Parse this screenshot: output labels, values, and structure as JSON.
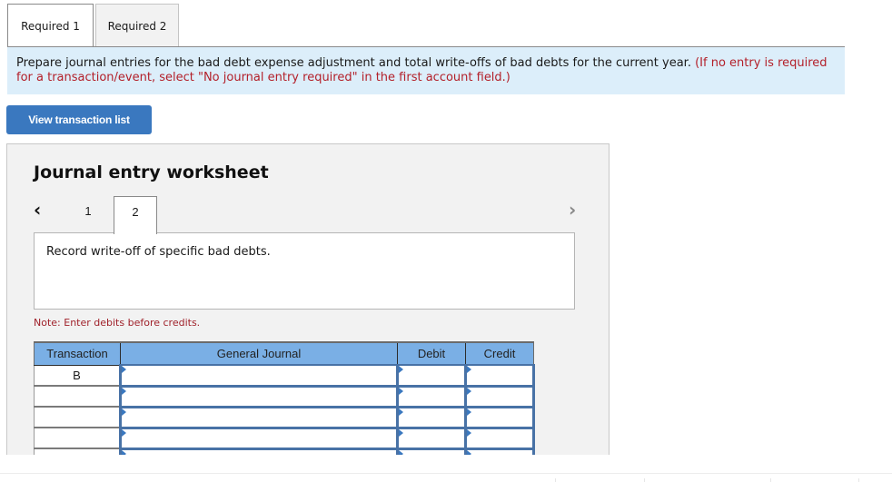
{
  "tabs": [
    {
      "label": "Required 1",
      "active": true
    },
    {
      "label": "Required 2",
      "active": false
    }
  ],
  "instructions": {
    "main": "Prepare journal entries for the bad debt expense adjustment and total write-offs of bad debts for the current year. ",
    "note": "(If no entry is required for a transaction/event, select \"No journal entry required\" in the first account field.)"
  },
  "view_button": {
    "label": "View transaction list"
  },
  "worksheet": {
    "title": "Journal entry worksheet",
    "prev_icon": "chevron-left-icon",
    "next_icon": "chevron-right-icon",
    "entries": [
      {
        "label": "1",
        "active": false
      },
      {
        "label": "2",
        "active": true
      }
    ],
    "description": "Record write-off of specific bad debts.",
    "note": "Note: Enter debits before credits.",
    "table": {
      "headers": [
        "Transaction",
        "General Journal",
        "Debit",
        "Credit"
      ],
      "rows": [
        {
          "transaction": "B",
          "account": "",
          "debit": "",
          "credit": ""
        },
        {
          "transaction": "",
          "account": "",
          "debit": "",
          "credit": ""
        },
        {
          "transaction": "",
          "account": "",
          "debit": "",
          "credit": ""
        },
        {
          "transaction": "",
          "account": "",
          "debit": "",
          "credit": ""
        },
        {
          "transaction": "",
          "account": "",
          "debit": "",
          "credit": ""
        }
      ]
    }
  },
  "colors": {
    "accent": "#3a78bf",
    "header_blue": "#7aafe5",
    "instruction_bg": "#dceefa",
    "note_red": "#b3202a"
  }
}
